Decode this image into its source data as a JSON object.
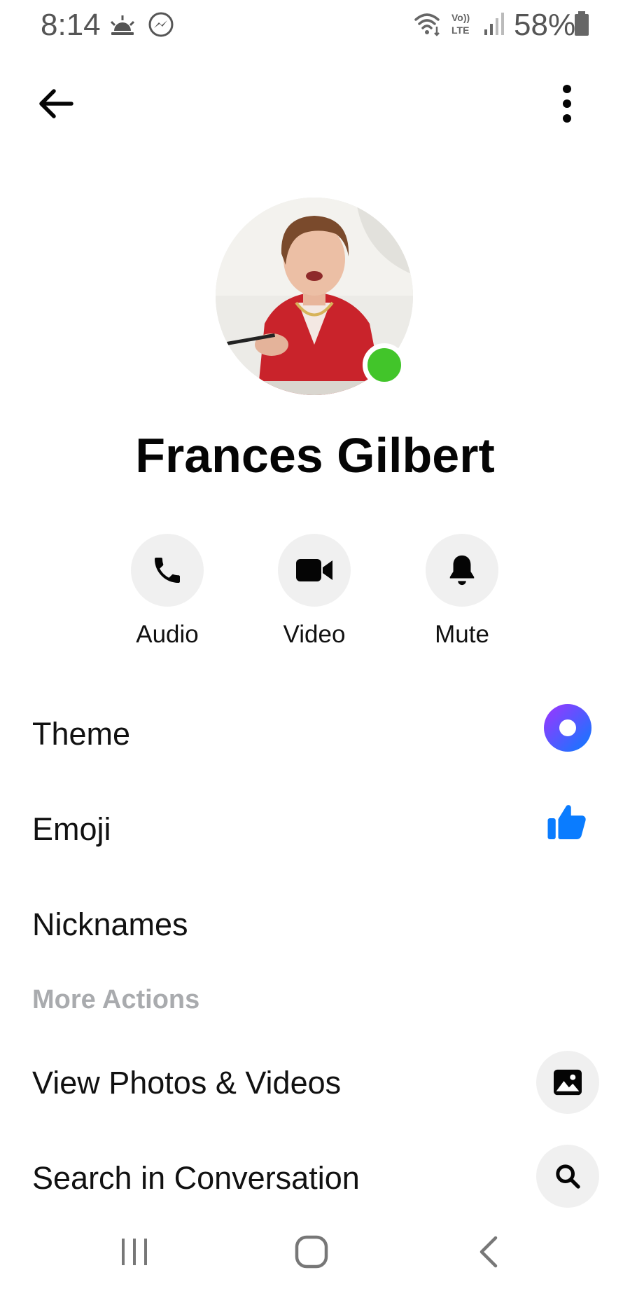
{
  "status_bar": {
    "time": "8:14",
    "battery": "58%"
  },
  "profile": {
    "name": "Frances Gilbert",
    "online": true,
    "presence_color": "#42c52a"
  },
  "actions": [
    {
      "label": "Audio",
      "icon": "phone-icon"
    },
    {
      "label": "Video",
      "icon": "video-camera-icon"
    },
    {
      "label": "Mute",
      "icon": "bell-icon"
    }
  ],
  "settings": {
    "theme_label": "Theme",
    "emoji_label": "Emoji",
    "nicknames_label": "Nicknames"
  },
  "more_actions": {
    "header": "More Actions",
    "items": [
      {
        "label": "View Photos & Videos",
        "icon": "photo-icon"
      },
      {
        "label": "Search in Conversation",
        "icon": "search-icon"
      }
    ]
  },
  "colors": {
    "accent_blue": "#0a7cff",
    "theme_gradient_start": "#a033ff",
    "theme_gradient_end": "#0a7cff"
  }
}
